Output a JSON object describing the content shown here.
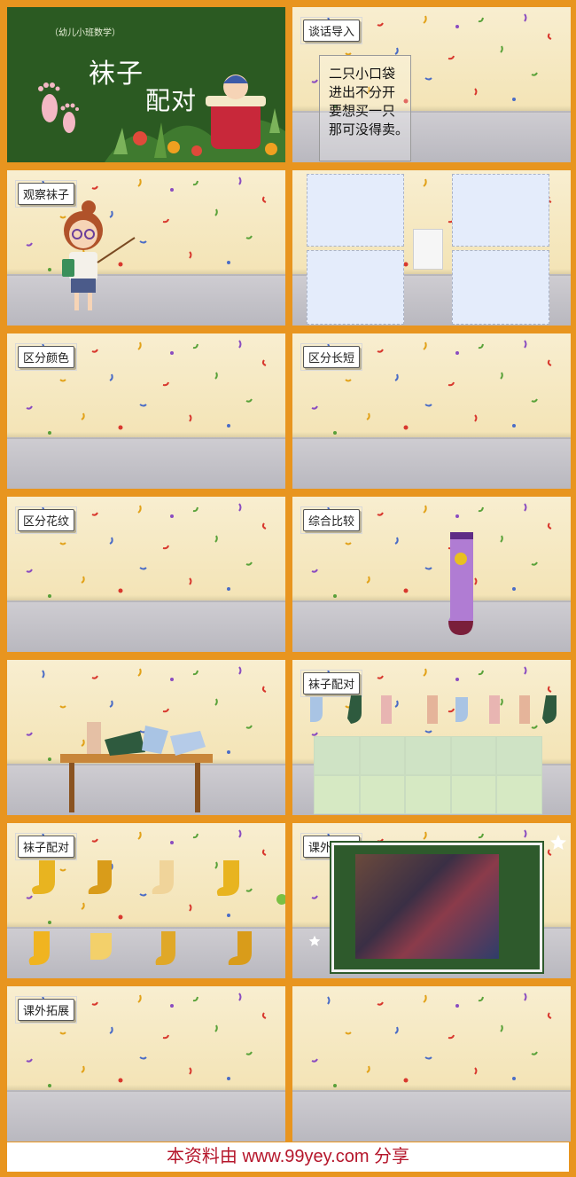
{
  "slides": {
    "cover": {
      "subtitle": "（幼儿小班数学）",
      "title_line1": "袜子",
      "title_line2": "配对"
    },
    "s2": {
      "tag": "谈话导入",
      "poem": [
        "二只小口袋",
        "进出不分开",
        "要想买一只",
        "那可没得卖。"
      ]
    },
    "s3": {
      "tag": "观察袜子"
    },
    "s5": {
      "tag": "区分颜色"
    },
    "s6": {
      "tag": "区分长短"
    },
    "s7": {
      "tag": "区分花纹"
    },
    "s8": {
      "tag": "综合比较"
    },
    "s10": {
      "tag": "袜子配对"
    },
    "s11": {
      "tag": "袜子配对"
    },
    "s12": {
      "tag": "课外拓展"
    },
    "s13": {
      "tag": "课外拓展"
    }
  },
  "footer": "本资料由 www.99yey.com 分享",
  "colors": {
    "frame": "#e8951f",
    "cover_green": "#2b5a22",
    "footer_text": "#b5162b"
  }
}
